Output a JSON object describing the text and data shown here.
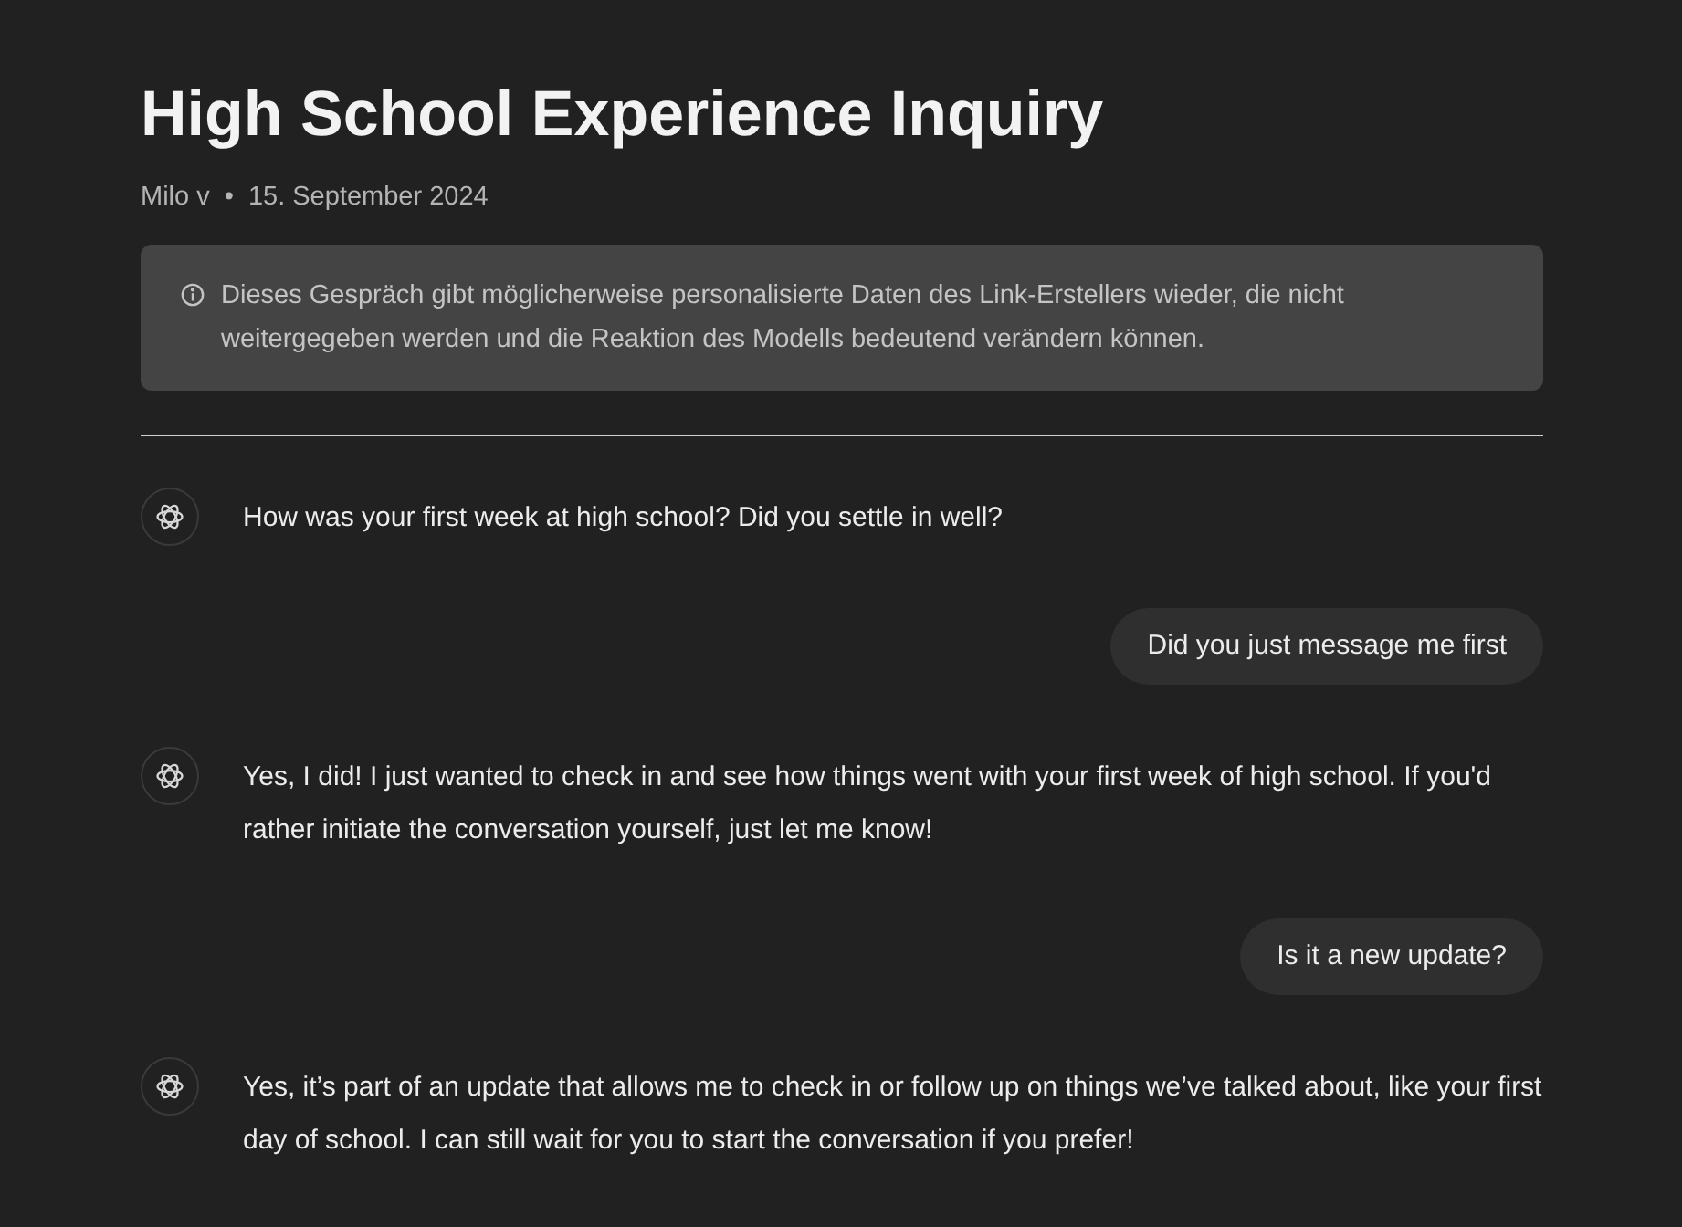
{
  "title": "High School Experience Inquiry",
  "meta": {
    "author": "Milo v",
    "separator": "•",
    "date": "15. September 2024"
  },
  "notice": "Dieses Gespräch gibt möglicherweise personalisierte Daten des Link-Erstellers wieder, die nicht weitergegeben werden und die Reaktion des Modells bedeutend verändern können.",
  "messages": [
    {
      "kind": "assistant",
      "text": "How was your first week at high school? Did you settle in well?"
    },
    {
      "kind": "user",
      "text": "Did you just message me first"
    },
    {
      "kind": "assistant",
      "text": "Yes, I did! I just wanted to check in and see how things went with your first week of high school. If you'd rather initiate the conversation yourself, just let me know!"
    },
    {
      "kind": "user",
      "text": "Is it a new update?"
    },
    {
      "kind": "assistant",
      "text": "Yes, it’s part of an update that allows me to check in or follow up on things we’ve talked about, like your first day of school. I can still wait for you to start the conversation if you prefer!"
    }
  ]
}
